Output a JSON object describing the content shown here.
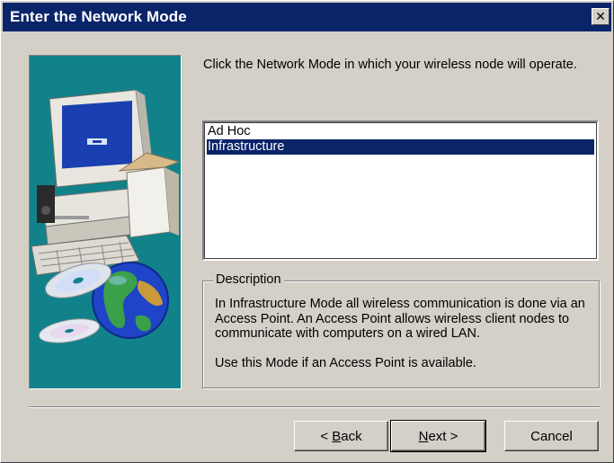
{
  "window": {
    "title": "Enter the Network Mode"
  },
  "dialog": {
    "instruction": "Click the Network Mode in which your wireless node will operate.",
    "modes": [
      {
        "label": "Ad Hoc",
        "selected": false
      },
      {
        "label": "Infrastructure",
        "selected": true
      }
    ],
    "description": {
      "legend": "Description",
      "text": "In Infrastructure Mode all wireless communication is done via an Access Point.  An Access Point allows wireless client nodes to communicate with computers on a wired LAN.",
      "note": "Use this Mode if an Access Point is available."
    }
  },
  "buttons": {
    "back": {
      "pre": "< ",
      "mnemonic": "B",
      "post": "ack"
    },
    "next": {
      "mnemonic": "N",
      "post": "ext >"
    },
    "cancel": "Cancel"
  },
  "icons": {
    "close": "close-icon",
    "illustration": [
      "computer-illustration",
      "cd-disc-icon",
      "globe-icon"
    ]
  },
  "colors": {
    "titlebar": "#0a246a",
    "dialog_bg": "#d4d0c8",
    "art_panel": "#12828a",
    "selection": "#0a246a"
  }
}
